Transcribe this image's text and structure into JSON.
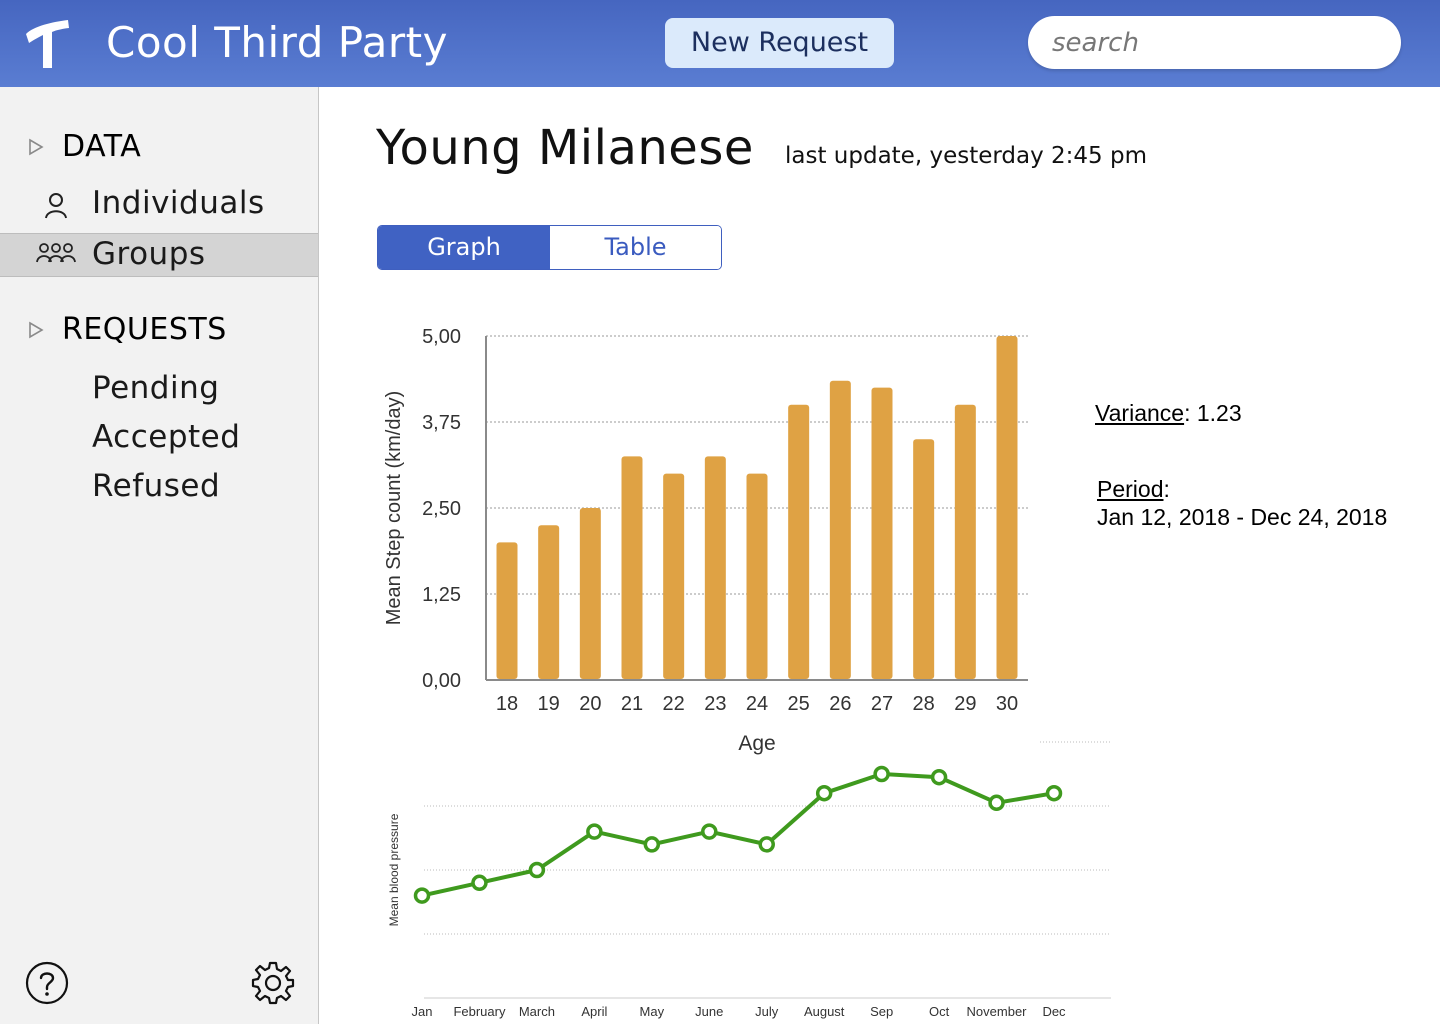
{
  "header": {
    "app_title": "Cool Third Party",
    "new_request_label": "New Request",
    "search_placeholder": "search",
    "brand_color": "#4a6cc6"
  },
  "sidebar": {
    "sections": [
      {
        "label": "DATA",
        "items": [
          {
            "label": "Individuals",
            "icon": "person-icon",
            "selected": false
          },
          {
            "label": "Groups",
            "icon": "group-icon",
            "selected": true
          }
        ]
      },
      {
        "label": "REQUESTS",
        "items": [
          {
            "label": "Pending",
            "selected": false
          },
          {
            "label": "Accepted",
            "selected": false
          },
          {
            "label": "Refused",
            "selected": false
          }
        ]
      }
    ],
    "footer_icons": [
      "help-icon",
      "gear-icon"
    ]
  },
  "main": {
    "title": "Young Milanese",
    "last_update": "last update, yesterday 2:45 pm",
    "tabs": [
      {
        "label": "Graph",
        "active": true
      },
      {
        "label": "Table",
        "active": false
      }
    ],
    "stats": {
      "variance_label": "Variance",
      "variance_value": ": 1.23",
      "period_label": "Period",
      "period_colon": ":",
      "period_value": "Jan 12, 2018 - Dec 24, 2018"
    }
  },
  "chart_data": [
    {
      "type": "bar",
      "categories": [
        "18",
        "19",
        "20",
        "21",
        "22",
        "23",
        "24",
        "25",
        "26",
        "27",
        "28",
        "29",
        "30"
      ],
      "values": [
        2.0,
        2.25,
        2.5,
        3.25,
        3.0,
        3.25,
        3.0,
        4.0,
        4.35,
        4.25,
        3.5,
        4.0,
        5.0
      ],
      "title": "",
      "xlabel": "Age",
      "ylabel": "Mean Step count  (km/day)",
      "ylim": [
        0,
        5
      ],
      "yticks": [
        "0,00",
        "1,25",
        "2,50",
        "3,75",
        "5,00"
      ],
      "grid": true,
      "bar_color": "#dfa244"
    },
    {
      "type": "line",
      "categories": [
        "Jan",
        "February",
        "March",
        "April",
        "May",
        "June",
        "July",
        "August",
        "Sep",
        "Oct",
        "November",
        "Dec"
      ],
      "values": [
        1.6,
        1.8,
        2.0,
        2.6,
        2.4,
        2.6,
        2.4,
        3.2,
        3.5,
        3.45,
        3.05,
        3.2
      ],
      "ylim": [
        0,
        4
      ],
      "ylabel": "Mean blood pressure",
      "xlabel": "",
      "grid": true,
      "line_color": "#3f9a1e"
    }
  ]
}
